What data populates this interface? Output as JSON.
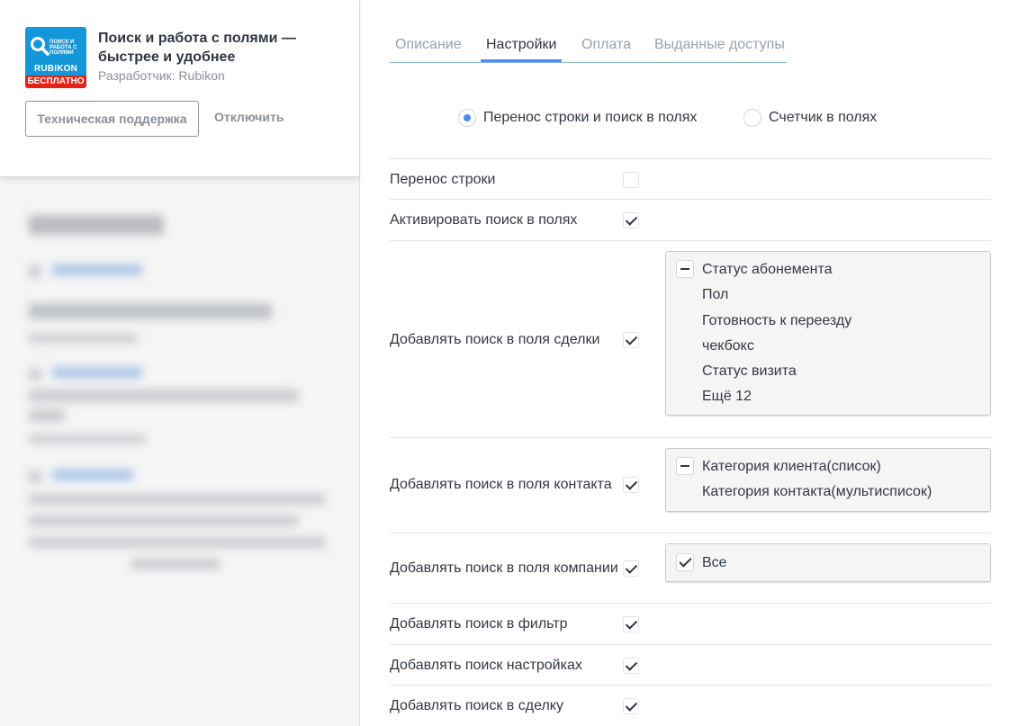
{
  "widget": {
    "logo": {
      "small_text": "ПОИСК И РАБОТА С ПОЛЯМИ",
      "brand": "RUBIKON",
      "badge": "БЕСПЛАТНО",
      "color": "#1497d9",
      "badge_color": "#e2231a"
    },
    "title": "Поиск и работа с полями — быстрее и удобнее",
    "developer": "Разработчик: Rubikon",
    "support_button": "Техническая поддержка",
    "disable_button": "Отключить"
  },
  "tabs": [
    {
      "label": "Описание",
      "active": false
    },
    {
      "label": "Настройки",
      "active": true
    },
    {
      "label": "Оплата",
      "active": false
    },
    {
      "label": "Выданные доступы",
      "active": false
    }
  ],
  "mode": {
    "options": [
      {
        "label": "Перенос строки и поиск в полях",
        "selected": true
      },
      {
        "label": "Счетчик в полях",
        "selected": false
      }
    ]
  },
  "settings": {
    "rows": [
      {
        "label": "Перенос строки",
        "checked": false
      },
      {
        "label": "Активировать поиск в полях",
        "checked": true
      },
      {
        "label": "Добавлять поиск в поля сделки",
        "checked": true,
        "list": {
          "toggle": "minus",
          "items": [
            "Статус абонемента",
            "Пол",
            "Готовность к переезду",
            "чекбокс",
            "Статус визита",
            "Ещё 12"
          ]
        }
      },
      {
        "label": "Добавлять поиск в поля контакта",
        "checked": true,
        "list": {
          "toggle": "minus",
          "items": [
            "Категория клиента(список)",
            "Категория контакта(мультисписок)"
          ]
        }
      },
      {
        "label": "Добавлять поиск в поля компании",
        "checked": true,
        "list": {
          "toggle": "check",
          "items": [
            "Все"
          ]
        }
      },
      {
        "label": "Добавлять поиск в фильтр",
        "checked": true
      },
      {
        "label": "Добавлять поиск настройках",
        "checked": true
      },
      {
        "label": "Добавлять поиск в сделку",
        "checked": true
      }
    ]
  },
  "colors": {
    "accent": "#4c8bf5",
    "text": "#313942",
    "muted": "#9aa1a8"
  }
}
